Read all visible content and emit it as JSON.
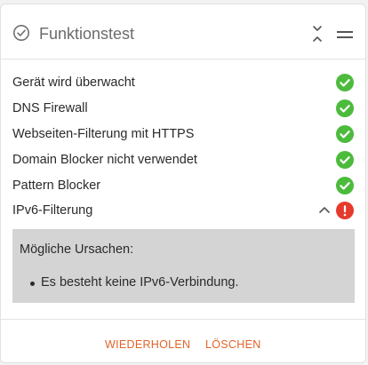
{
  "header": {
    "title": "Funktionstest",
    "icon": "check-circle-icon",
    "collapse_icon": "collapse-icon",
    "menu_icon": "drag-handle-icon"
  },
  "checks": [
    {
      "label": "Gerät wird überwacht",
      "status": "ok"
    },
    {
      "label": "DNS Firewall",
      "status": "ok"
    },
    {
      "label": "Webseiten-Filterung mit HTTPS",
      "status": "ok"
    },
    {
      "label": "Domain Blocker nicht verwendet",
      "status": "ok"
    },
    {
      "label": "Pattern Blocker",
      "status": "ok"
    },
    {
      "label": "IPv6-Filterung",
      "status": "error",
      "expanded": true
    }
  ],
  "details": {
    "title": "Mögliche Ursachen:",
    "items": [
      "Es besteht keine IPv6-Verbindung."
    ]
  },
  "footer": {
    "retry_label": "WIEDERHOLEN",
    "delete_label": "LÖSCHEN"
  },
  "colors": {
    "ok": "#4cbb3c",
    "error": "#e53a2c",
    "accent": "#e0642a"
  }
}
